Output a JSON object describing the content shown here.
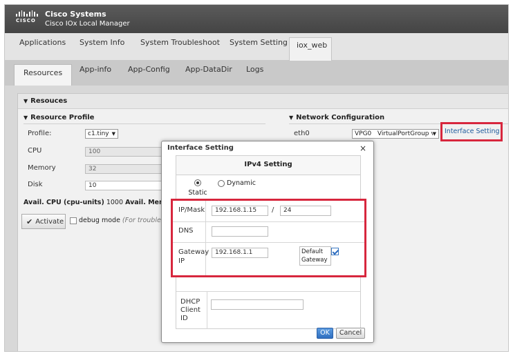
{
  "header": {
    "logo_text": "CISCO",
    "brand_title": "Cisco Systems",
    "brand_subtitle": "Cisco IOx Local Manager"
  },
  "nav_tabs": [
    "Applications",
    "System Info",
    "System Troubleshoot",
    "System Setting",
    "iox_web"
  ],
  "active_nav_tab": "iox_web",
  "sub_tabs": [
    "Resources",
    "App-info",
    "App-Config",
    "App-DataDir",
    "Logs"
  ],
  "active_sub_tab": "Resources",
  "resources": {
    "panel_title": "Resouces",
    "profile_section": "Resource Profile",
    "profile_label": "Profile:",
    "profile_value": "c1.tiny",
    "cpu_label": "CPU",
    "cpu_value": "100",
    "memory_label": "Memory",
    "memory_value": "32",
    "disk_label": "Disk",
    "disk_value": "10",
    "avail_cpu_label": "Avail. CPU (cpu-units)",
    "avail_cpu_value": "1000",
    "avail_mem_label": "Avail. Memo",
    "activate_label": "Activate",
    "debug_label": "debug mode",
    "debug_hint": "(For troubleshoo"
  },
  "network": {
    "section": "Network Configuration",
    "iface": "eth0",
    "select_value": "VPG0   VirtualPortGroup vi",
    "link": "Interface Setting"
  },
  "dialog": {
    "title": "Interface Setting",
    "close": "×",
    "section": "IPv4 Setting",
    "static_label": "Static",
    "dynamic_label": "Dynamic",
    "mode": "static",
    "ip_mask_label": "IP/Mask",
    "ip_value": "192.168.1.15",
    "slash": "/",
    "mask_value": "24",
    "dns_label": "DNS",
    "dns_value": "",
    "gateway_label_1": "Gateway",
    "gateway_label_2": "IP",
    "gateway_value": "192.168.1.1",
    "default_gw_label_1": "Default",
    "default_gw_label_2": "Gateway",
    "default_gw_checked": true,
    "dhcp_label_1": "DHCP",
    "dhcp_label_2": "Client",
    "dhcp_label_3": "ID",
    "dhcp_value": "",
    "ok_label": "OK",
    "cancel_label": "Cancel"
  },
  "colors": {
    "highlight": "#d7263d",
    "link": "#1c5a9c",
    "header": "#4c4c4c"
  }
}
